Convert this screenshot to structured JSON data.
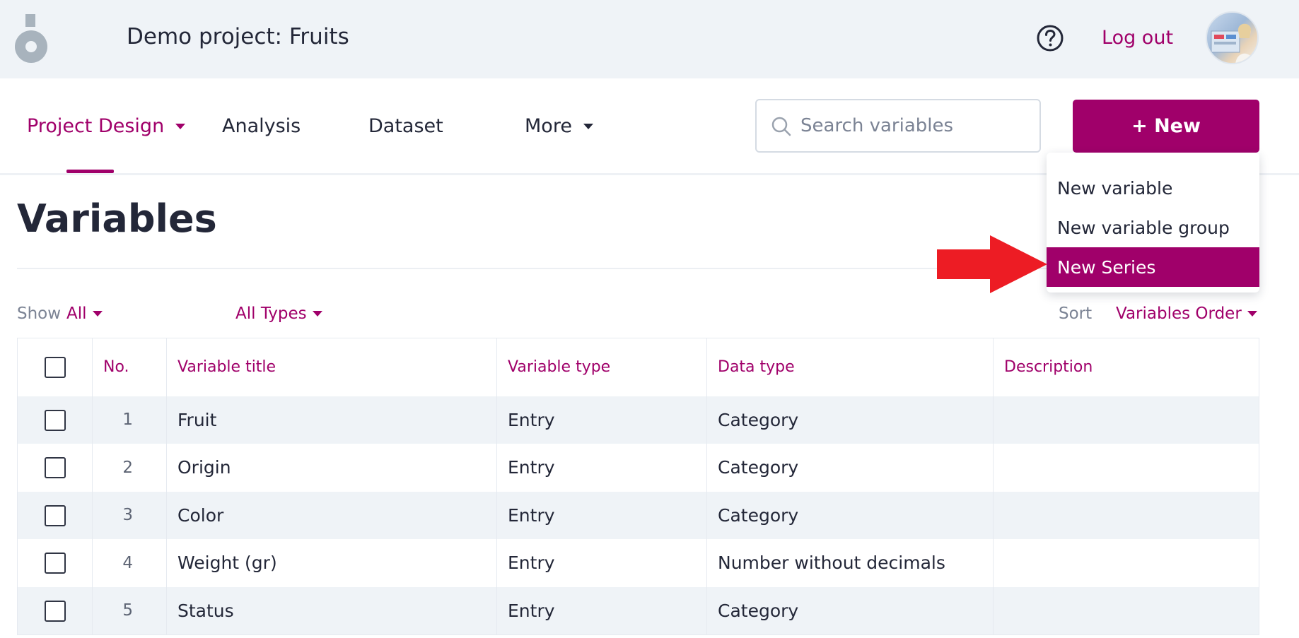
{
  "header": {
    "project_title": "Demo project: Fruits",
    "logout_label": "Log out",
    "help_icon": "question-circle-icon",
    "avatar_icon": "user-avatar"
  },
  "nav": {
    "items": [
      {
        "label": "Project Design",
        "active": true,
        "has_caret": true
      },
      {
        "label": "Analysis",
        "active": false,
        "has_caret": false
      },
      {
        "label": "Dataset",
        "active": false,
        "has_caret": false
      },
      {
        "label": "More",
        "active": false,
        "has_caret": true
      }
    ],
    "search": {
      "placeholder": "Search variables",
      "value": ""
    },
    "new_button_label": "+ New"
  },
  "new_menu": {
    "items": [
      {
        "label": "New variable",
        "selected": false
      },
      {
        "label": "New variable group",
        "selected": false
      },
      {
        "label": "New Series",
        "selected": true
      }
    ],
    "annotation_arrow_color": "#ed1c24"
  },
  "page": {
    "title": "Variables"
  },
  "filters": {
    "show_label": "Show",
    "show_value": "All",
    "type_value": "All Types",
    "sort_label": "Sort",
    "sort_value": "Variables Order"
  },
  "table": {
    "columns": [
      "No.",
      "Variable title",
      "Variable type",
      "Data type",
      "Description"
    ],
    "rows": [
      {
        "no": "1",
        "title": "Fruit",
        "variable_type": "Entry",
        "data_type": "Category",
        "description": ""
      },
      {
        "no": "2",
        "title": "Origin",
        "variable_type": "Entry",
        "data_type": "Category",
        "description": ""
      },
      {
        "no": "3",
        "title": "Color",
        "variable_type": "Entry",
        "data_type": "Category",
        "description": ""
      },
      {
        "no": "4",
        "title": "Weight (gr)",
        "variable_type": "Entry",
        "data_type": "Number without decimals",
        "description": ""
      },
      {
        "no": "5",
        "title": "Status",
        "variable_type": "Entry",
        "data_type": "Category",
        "description": ""
      }
    ]
  },
  "colors": {
    "accent": "#a0006a",
    "header_bg": "#eff3f7",
    "text": "#232738"
  }
}
